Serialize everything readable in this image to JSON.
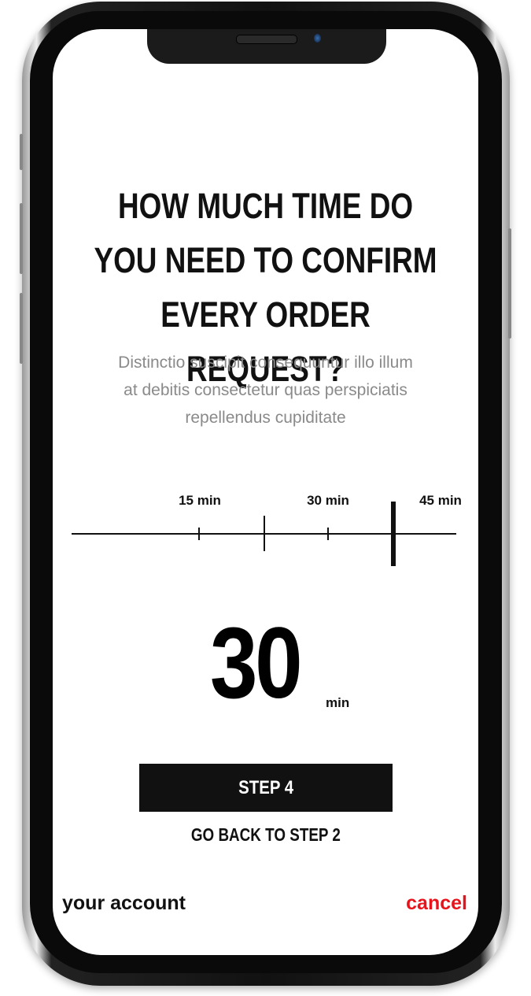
{
  "title": "HOW MUCH TIME DO YOU NEED TO CONFIRM EVERY ORDER REQUEST?",
  "title_lines": [
    "HOW MUCH TIME DO",
    "YOU NEED TO CONFIRM",
    "EVERY ORDER REQUEST?"
  ],
  "subtitle_lines": [
    "Distinctio suscipit consequuntur illo illum",
    "at debitis consectetur quas perspiciatis",
    "repellendus cupiditate"
  ],
  "timeline": {
    "labels": [
      "15 min",
      "30 min",
      "45 min"
    ],
    "selected_marker": "45 min"
  },
  "value": {
    "number": "30",
    "unit": "min"
  },
  "step_button": "STEP 4",
  "back_link": "GO BACK TO STEP 2",
  "footer": {
    "account": "your account",
    "cancel": "cancel"
  },
  "colors": {
    "accent": "#e8141c",
    "button_bg": "#111111"
  }
}
